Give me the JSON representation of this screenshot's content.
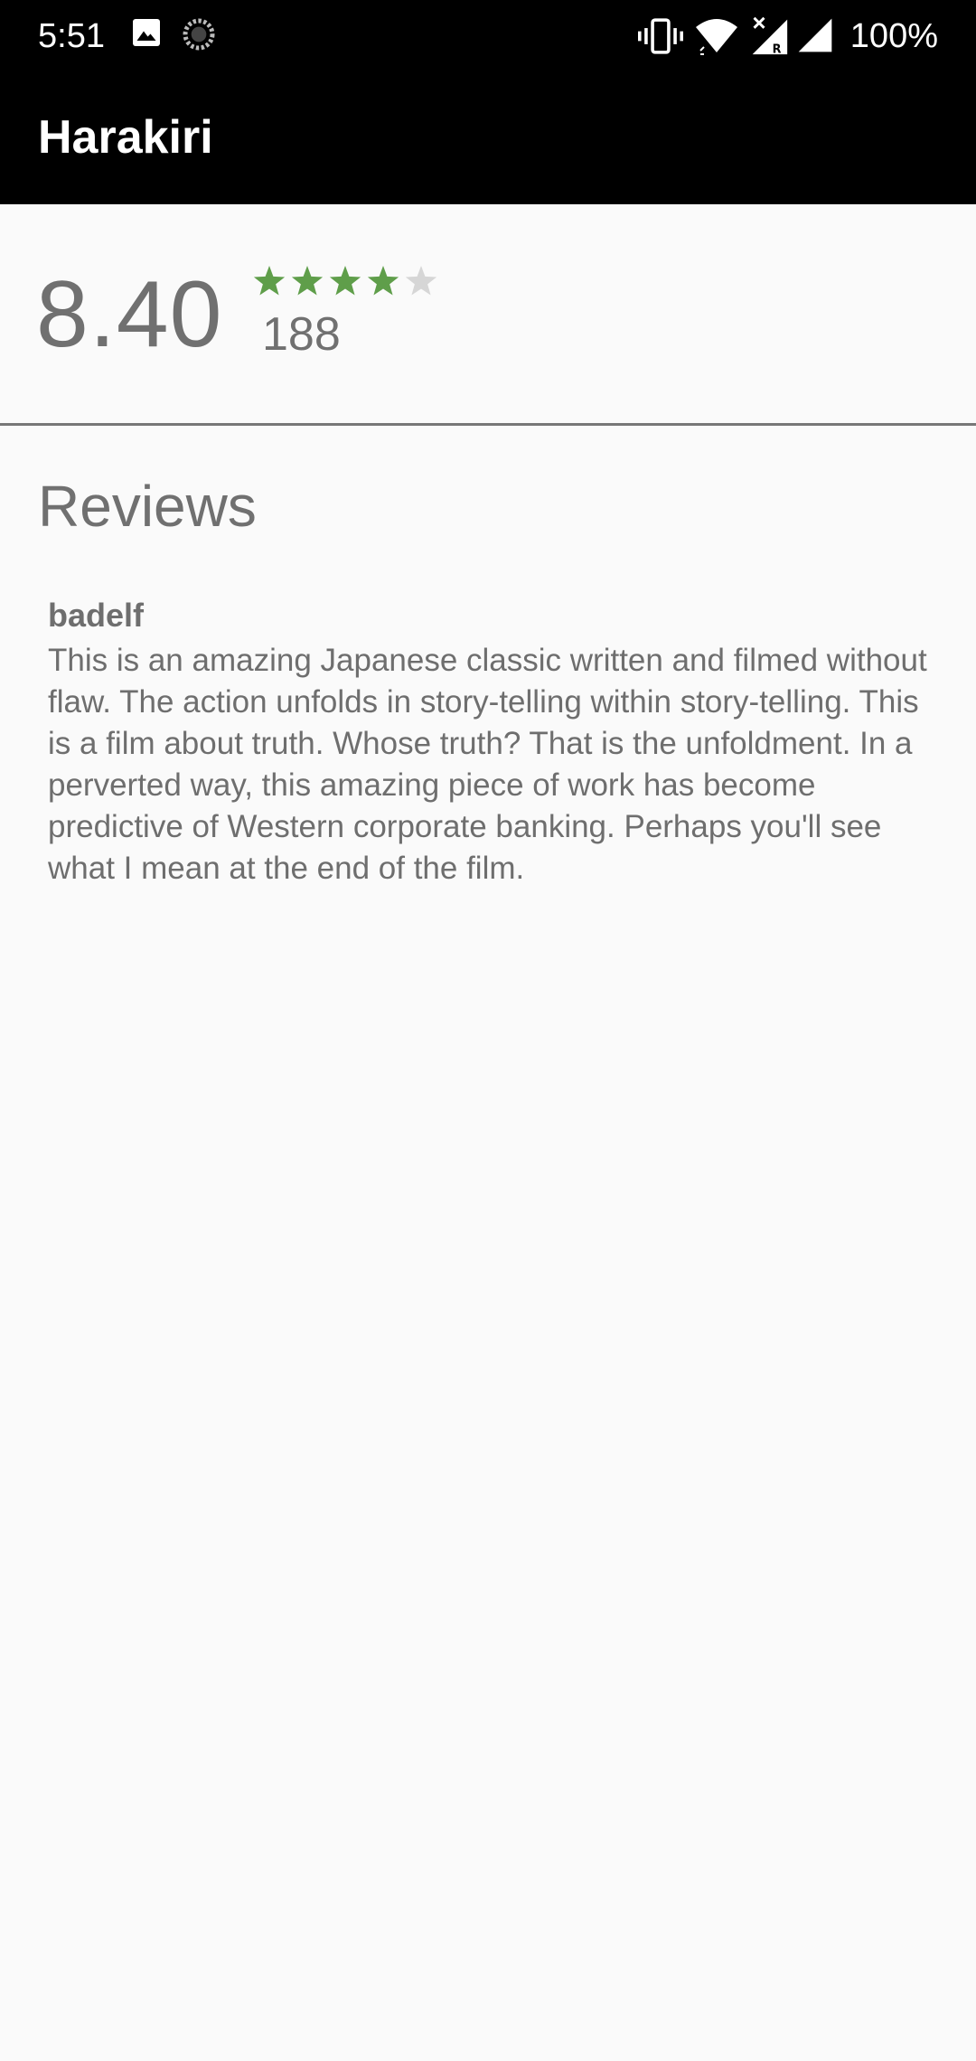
{
  "status_bar": {
    "time": "5:51",
    "battery": "100%",
    "icons": [
      "image-icon",
      "sync-icon",
      "vibrate-icon",
      "wifi-icon",
      "signal-roaming-icon",
      "signal-icon"
    ]
  },
  "app_bar": {
    "title": "Harakiri"
  },
  "rating": {
    "score": "8.40",
    "stars": 4,
    "max_stars": 5,
    "count": "188",
    "star_color": "#5f9e4a",
    "empty_star_color": "#d6d6d6"
  },
  "reviews": {
    "heading": "Reviews",
    "items": [
      {
        "author": "badelf",
        "text": "This is an amazing Japanese classic written and filmed without flaw. The action unfolds in story-telling within story-telling. This is a film about truth. Whose truth? That is the unfoldment. In a perverted way, this amazing piece of work has become predictive of Western corporate banking. Perhaps you'll see what I mean at the end of the film."
      }
    ]
  }
}
